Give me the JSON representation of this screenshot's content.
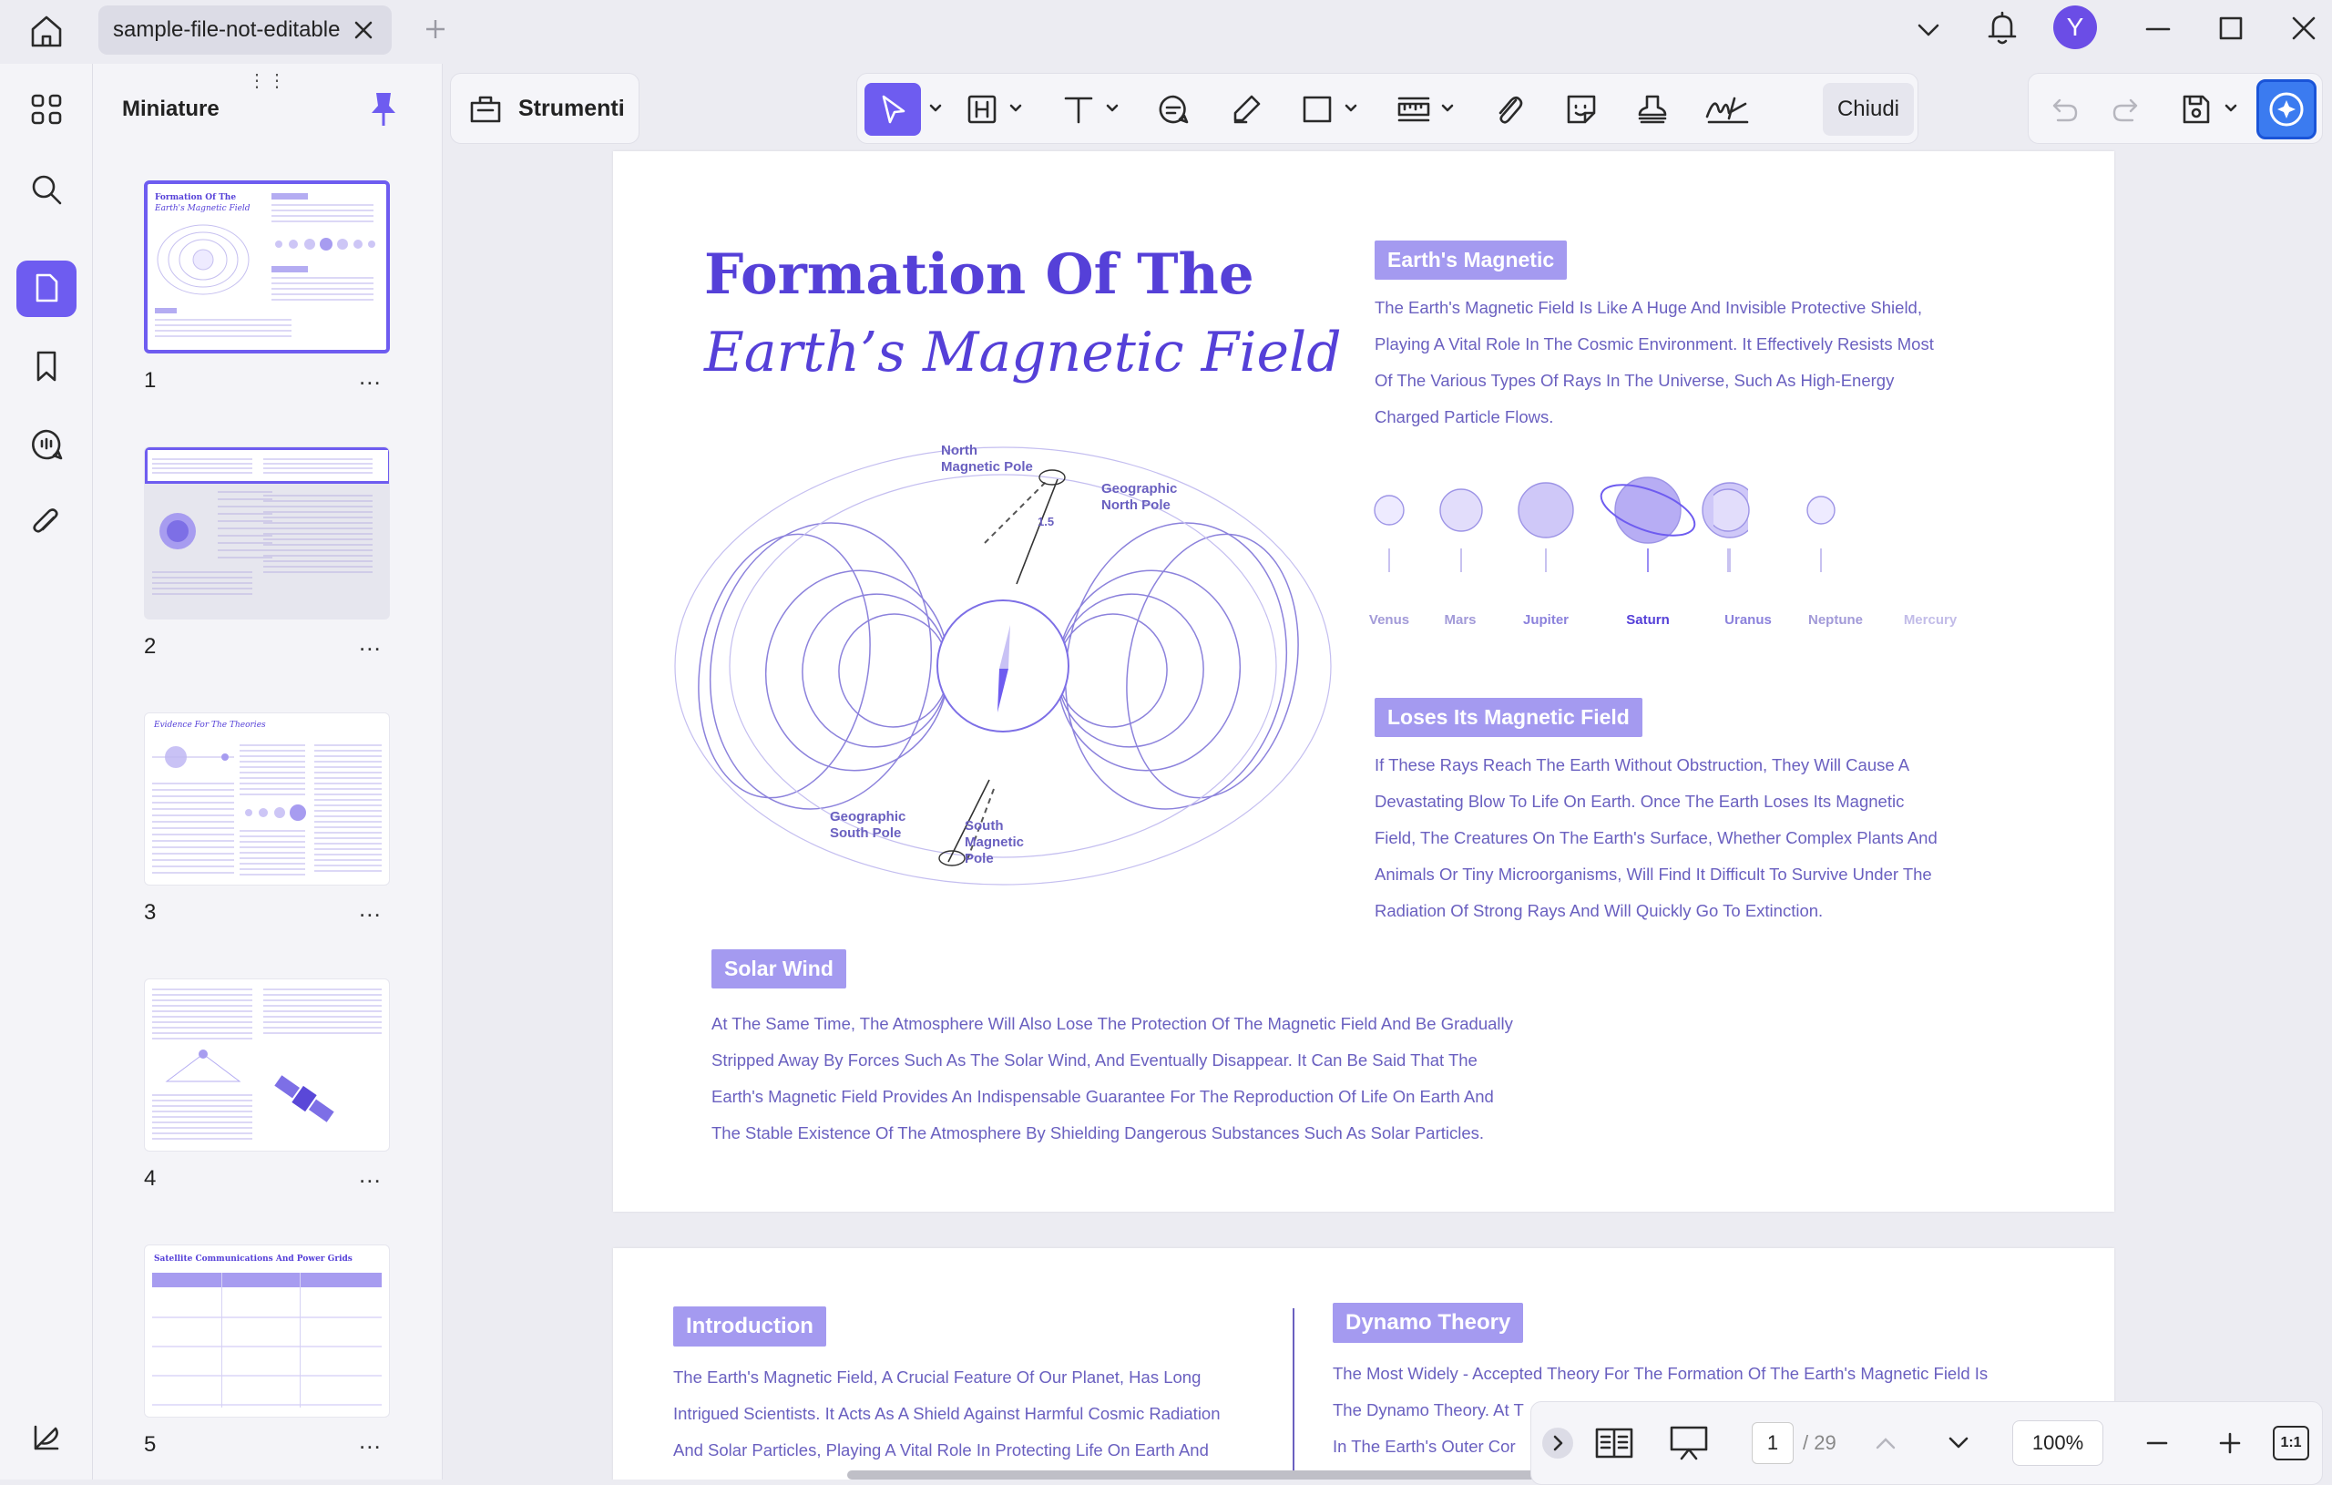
{
  "tab": {
    "title": "sample-file-not-editable"
  },
  "user": {
    "initial": "Y"
  },
  "panel": {
    "title": "Miniature",
    "more": "...",
    "pages": [
      {
        "num": "1",
        "thumb_title": "Formation Of The",
        "thumb_subtitle": "Earth's Magnetic Field"
      },
      {
        "num": "2"
      },
      {
        "num": "3",
        "thumb_title": "Evidence For The Theories"
      },
      {
        "num": "4"
      },
      {
        "num": "5",
        "thumb_title": "Satellite Communications And Power Grids"
      }
    ]
  },
  "toolbar": {
    "tools_label": "Strumenti",
    "close_label": "Chiudi"
  },
  "doc": {
    "title_line1": "Formation Of The",
    "title_line2": "Earth’s Magnetic Field",
    "magnetic": {
      "heading": "Earth's Magnetic",
      "lines": [
        "The Earth's Magnetic Field Is Like A Huge And Invisible Protective Shield,",
        "Playing A Vital Role In The Cosmic Environment. It Effectively Resists Most",
        "Of The Various Types Of Rays In The Universe, Such As High-Energy",
        "Charged Particle Flows."
      ]
    },
    "planets": [
      "Venus",
      "Mars",
      "Jupiter",
      "Saturn",
      "Uranus",
      "Neptune",
      "Mercury"
    ],
    "diagram": {
      "north_magnetic": [
        "North",
        "Magnetic Pole"
      ],
      "geo_north": [
        "Geographic",
        "North Pole"
      ],
      "geo_south": [
        "Geographic",
        "South Pole"
      ],
      "south_magnetic": [
        "South",
        "Magnetic",
        "Pole"
      ],
      "angle": "1.5"
    },
    "loses": {
      "heading": "Loses Its Magnetic Field",
      "lines": [
        "If These Rays Reach The Earth Without Obstruction, They Will Cause A",
        "Devastating Blow To Life On Earth. Once The Earth Loses Its Magnetic",
        "Field, The Creatures On The Earth's Surface, Whether Complex Plants And",
        "Animals Or Tiny Microorganisms, Will Find It Difficult To Survive Under The",
        "Radiation Of Strong Rays And Will Quickly Go To Extinction."
      ]
    },
    "solar": {
      "heading": "Solar Wind",
      "lines": [
        "At The Same Time, The Atmosphere Will Also Lose The Protection Of The Magnetic Field And Be Gradually",
        "Stripped Away By Forces Such As The Solar Wind, And Eventually Disappear. It Can Be Said That The",
        "Earth's Magnetic Field Provides An Indispensable Guarantee For The Reproduction Of Life On Earth And",
        "The Stable Existence Of The Atmosphere By Shielding Dangerous Substances Such As Solar Particles."
      ]
    },
    "intro": {
      "heading": "Introduction",
      "lines": [
        "The Earth's Magnetic Field, A Crucial Feature Of Our Planet, Has Long",
        "Intrigued Scientists. It Acts As A Shield Against Harmful Cosmic Radiation",
        "And Solar Particles, Playing A Vital Role In Protecting Life On Earth And"
      ]
    },
    "dynamo": {
      "heading": "Dynamo Theory",
      "lines": [
        "The Most Widely - Accepted Theory For The Formation Of The Earth's Magnetic Field Is",
        "The Dynamo Theory. At T",
        "In The Earth's Outer Cor"
      ]
    }
  },
  "bottom": {
    "page": "1",
    "total": "/ 29",
    "zoom": "100%",
    "fit": "1:1"
  }
}
